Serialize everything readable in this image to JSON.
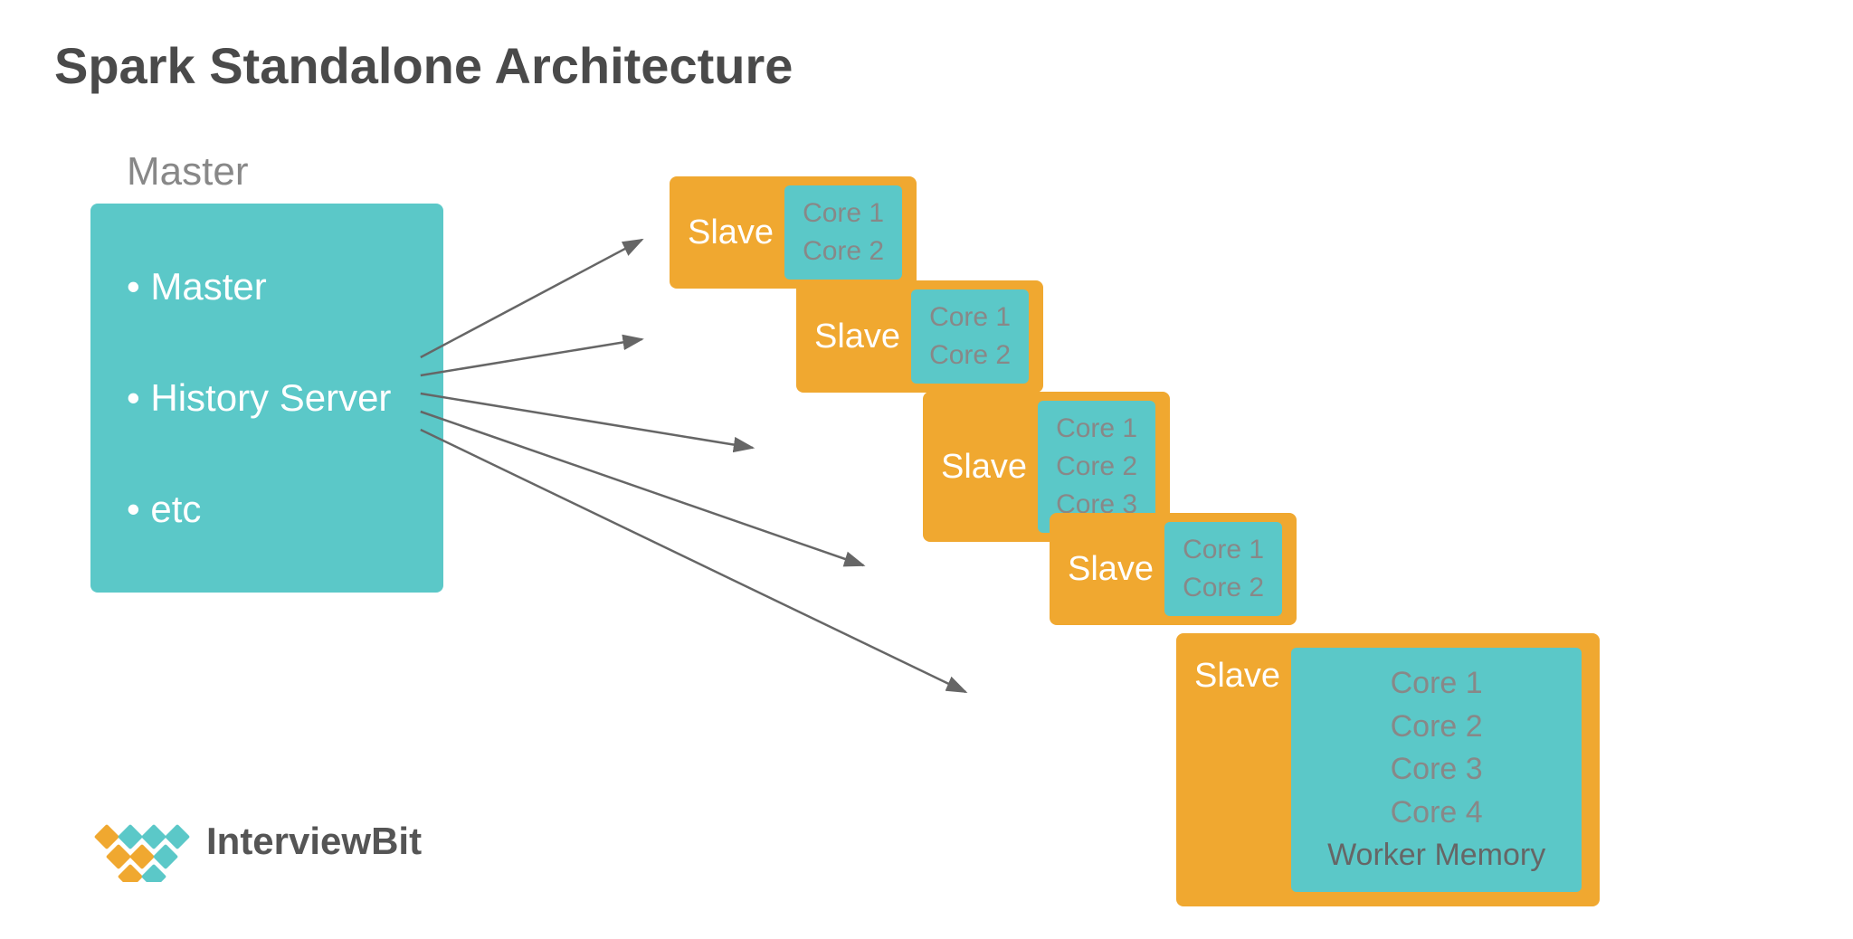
{
  "page": {
    "title": "Spark Standalone Architecture",
    "background": "#ffffff"
  },
  "master": {
    "label": "Master",
    "box_label": "Master",
    "items": [
      "• Master",
      "• History Server",
      "• etc"
    ]
  },
  "slaves": [
    {
      "id": 1,
      "label": "Slave",
      "cores": [
        "Core 1",
        "Core 2"
      ]
    },
    {
      "id": 2,
      "label": "Slave",
      "cores": [
        "Core 1",
        "Core 2"
      ]
    },
    {
      "id": 3,
      "label": "Slave",
      "cores": [
        "Core 1",
        "Core 2",
        "Core 3"
      ]
    },
    {
      "id": 4,
      "label": "Slave",
      "cores": [
        "Core 1",
        "Core 2"
      ]
    },
    {
      "id": 5,
      "label": "Slave",
      "cores": [
        "Core 1",
        "Core 2",
        "Core 3",
        "Core 4",
        "Worker Memory"
      ]
    }
  ],
  "logo": {
    "brand": "InterviewBit",
    "brand_plain": "Interview",
    "brand_bold": "Bit"
  },
  "colors": {
    "teal": "#5bc8c8",
    "orange": "#f0a830",
    "text_dark": "#4a4a4a",
    "text_gray": "#888888",
    "white": "#ffffff"
  }
}
